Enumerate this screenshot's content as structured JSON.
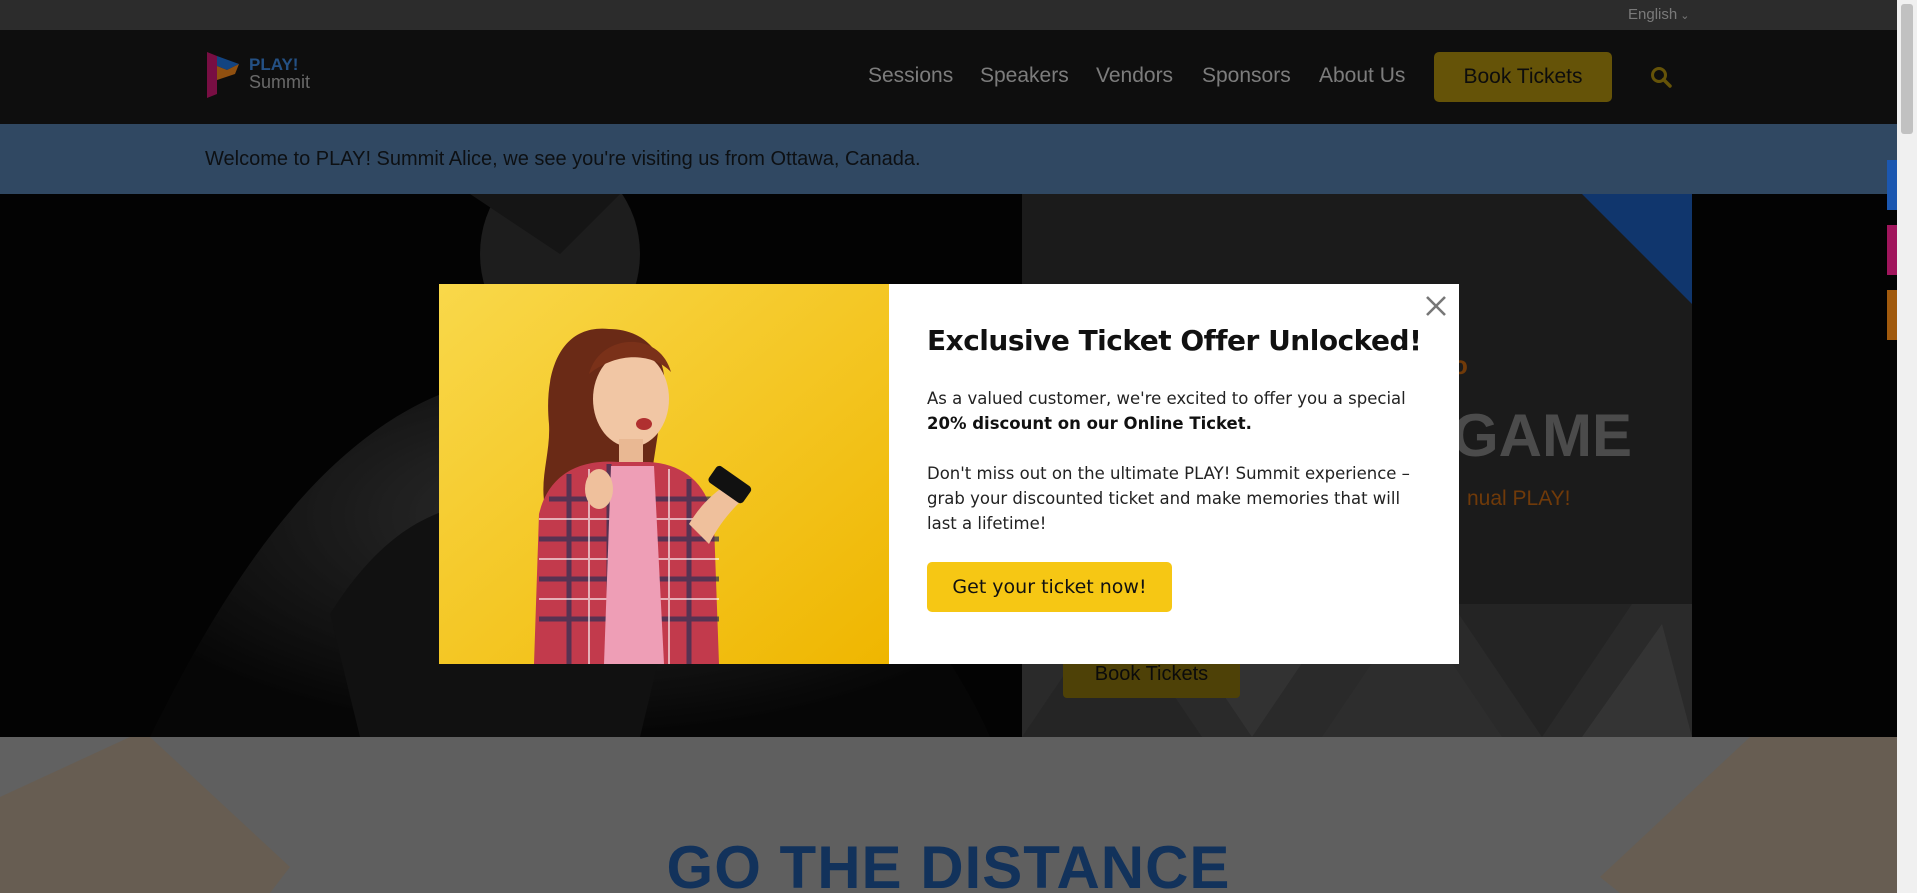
{
  "topbar": {
    "language": "English"
  },
  "header": {
    "logo": {
      "line1": "PLAY!",
      "line2": "Summit"
    },
    "nav": [
      "Sessions",
      "Speakers",
      "Vendors",
      "Sponsors",
      "About Us"
    ],
    "book_label": "Book Tickets"
  },
  "welcome": {
    "text": "Welcome to PLAY! Summit Alice, we see you're visiting us from Ottawa, Canada."
  },
  "hero": {
    "title_visible": "GAME",
    "subtitle_visible": "nual PLAY!",
    "small_visible": "o",
    "book_label": "Book Tickets"
  },
  "band": {
    "title": "GO THE DISTANCE"
  },
  "modal": {
    "title": "Exclusive Ticket Offer Unlocked!",
    "p1_lead": "As a valued customer, we're excited to offer you a special",
    "p1_bold": "20% discount on our Online Ticket.",
    "p2": "Don't miss out on the ultimate PLAY! Summit experience – grab your discounted ticket and make memories that will last a lifetime!",
    "cta": "Get your ticket now!"
  },
  "colors": {
    "accent_yellow": "#f6c714",
    "header_bg": "#171717",
    "welcome_bg": "#4e759e",
    "brand_blue": "#1e5193",
    "hero_orange": "#b55e10"
  },
  "icons": [
    "chevron-down-icon",
    "play-logo-icon",
    "search-icon",
    "close-icon"
  ]
}
